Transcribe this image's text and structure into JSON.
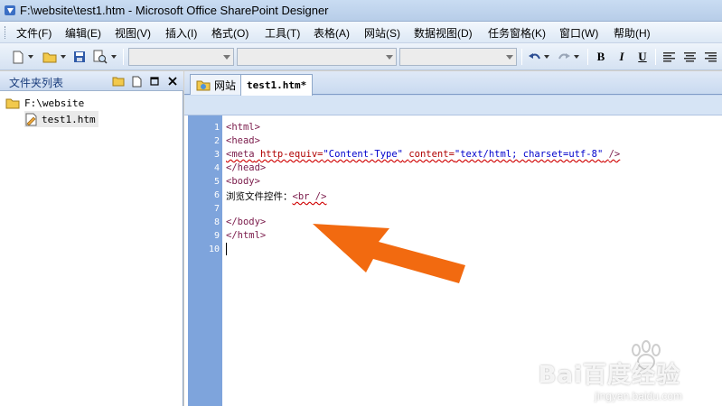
{
  "window": {
    "title": "F:\\website\\test1.htm - Microsoft Office SharePoint Designer"
  },
  "menubar": {
    "items": [
      {
        "label": "文件(F)"
      },
      {
        "label": "编辑(E)"
      },
      {
        "label": "视图(V)"
      },
      {
        "label": "插入(I)"
      },
      {
        "label": "格式(O)"
      },
      {
        "label": "工具(T)"
      },
      {
        "label": "表格(A)"
      },
      {
        "label": "网站(S)"
      },
      {
        "label": "数据视图(D)"
      },
      {
        "label": "任务窗格(K)"
      },
      {
        "label": "窗口(W)"
      },
      {
        "label": "帮助(H)"
      }
    ]
  },
  "toolbar": {
    "bold_label": "B",
    "italic_label": "I",
    "underline_label": "U",
    "style_combo_value": "",
    "font_combo_value": "",
    "size_combo_value": ""
  },
  "folder_pane": {
    "title": "文件夹列表",
    "tree": [
      {
        "label": "F:\\website",
        "icon": "folder-icon"
      },
      {
        "label": "test1.htm",
        "icon": "html-file-icon"
      }
    ]
  },
  "editor": {
    "tabs": [
      {
        "label": "网站",
        "icon": "website-icon"
      },
      {
        "label": "test1.htm*"
      }
    ],
    "line_numbers": [
      "1",
      "2",
      "3",
      "4",
      "5",
      "6",
      "7",
      "8",
      "9",
      "10"
    ],
    "code": {
      "l1": "<html>",
      "l2": "<head>",
      "l3_tag_open": "<meta",
      "l3_attr1": "http-equiv=",
      "l3_val1": "\"Content-Type\"",
      "l3_attr2": "content=",
      "l3_val2": "\"text/html; charset=utf-8\"",
      "l3_tag_close": "/>",
      "l4": "</head>",
      "l5": "<body>",
      "l6_text": "浏览文件控件：",
      "l6_tag": "<br />",
      "l8": "</body>",
      "l9": "</html>"
    }
  },
  "watermark": {
    "brand": "Bai百度经验",
    "url": "jingyan.baidu.com"
  },
  "colors": {
    "annotation_arrow": "#f26a10",
    "gutter": "#7ea4dc",
    "tag": "#7a1a4a",
    "attr": "#b00000",
    "value": "#0000cc"
  }
}
